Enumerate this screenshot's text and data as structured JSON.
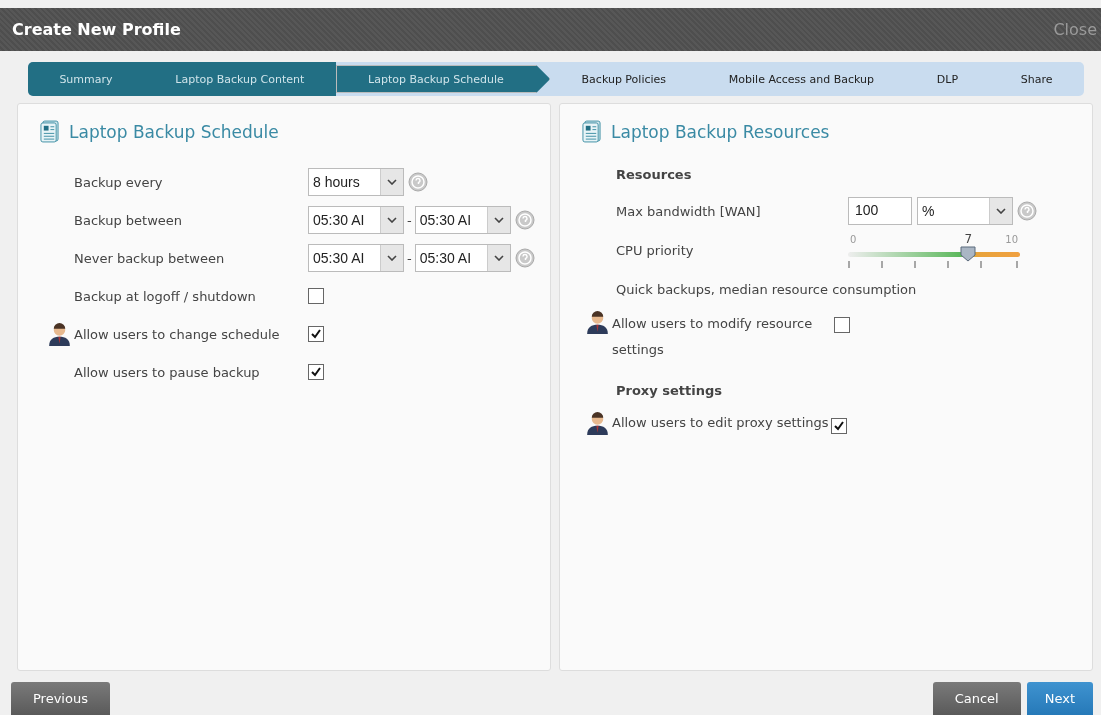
{
  "window": {
    "title": "Create New Profile",
    "close": "Close"
  },
  "steps": [
    {
      "label": "Summary",
      "done": true,
      "selected": false
    },
    {
      "label": "Laptop Backup Content",
      "done": true,
      "selected": false
    },
    {
      "label": "Laptop Backup Schedule",
      "done": true,
      "selected": true
    },
    {
      "label": "Backup Policies",
      "done": false,
      "selected": false
    },
    {
      "label": "Mobile Access and Backup",
      "done": false,
      "selected": false
    },
    {
      "label": "DLP",
      "done": false,
      "selected": false
    },
    {
      "label": "Share",
      "done": false,
      "selected": false
    }
  ],
  "schedule": {
    "title": "Laptop Backup Schedule",
    "rows": [
      {
        "kind": "select",
        "label": "Backup every",
        "user": false,
        "values": [
          "8 hours"
        ],
        "help": true
      },
      {
        "kind": "range",
        "label": "Backup between",
        "user": false,
        "values": [
          "05:30 AI",
          "05:30 AI"
        ],
        "separator": "-",
        "help": true
      },
      {
        "kind": "range",
        "label": "Never backup between",
        "user": false,
        "values": [
          "05:30 AI",
          "05:30 AI"
        ],
        "separator": "-",
        "help": true
      },
      {
        "kind": "checkbox",
        "label": "Backup at logoff / shutdown",
        "user": false,
        "checked": false
      },
      {
        "kind": "checkbox",
        "label": "Allow users to change schedule",
        "user": true,
        "checked": true
      },
      {
        "kind": "checkbox",
        "label": "Allow users to pause backup",
        "user": false,
        "checked": true
      }
    ]
  },
  "resources": {
    "title": "Laptop Backup Resources",
    "heading": "Resources",
    "bandwidth": {
      "label": "Max bandwidth [WAN]",
      "value": "100",
      "unit": "%",
      "help": true
    },
    "cpu": {
      "label": "CPU priority",
      "min": "0",
      "value": "7",
      "max": "10",
      "level": 0.7
    },
    "note": "Quick backups, median resource consumption",
    "modify": {
      "label": "Allow users to modify resource settings",
      "user": true,
      "checked": false
    },
    "proxy_heading": "Proxy settings",
    "proxy": {
      "label": "Allow users to edit proxy settings",
      "user": true,
      "checked": true
    }
  },
  "buttons": {
    "previous": "Previous",
    "cancel": "Cancel",
    "next": "Next"
  }
}
